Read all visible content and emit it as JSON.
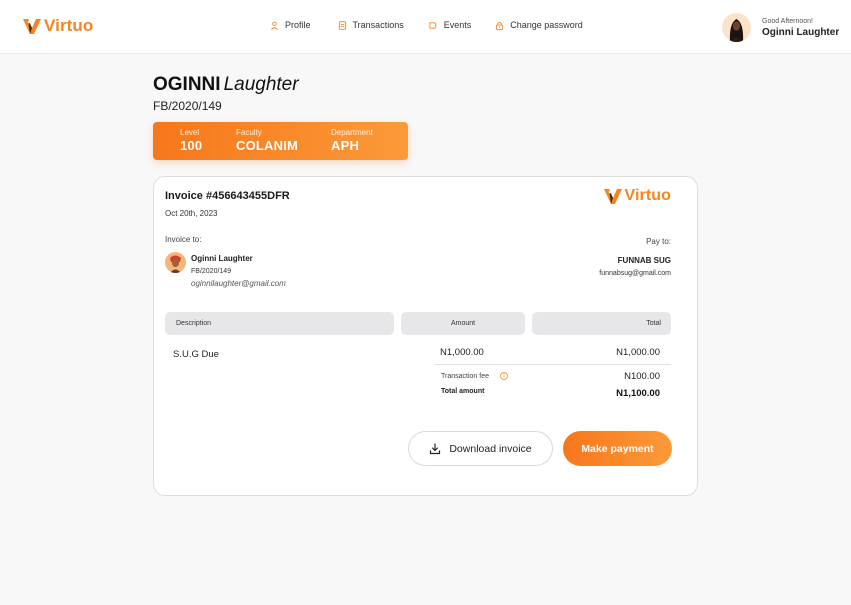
{
  "app": {
    "brand": "Virtuo",
    "accent_color": "#f7841f"
  },
  "nav": {
    "items": [
      {
        "label": "Profile",
        "icon": "user-icon"
      },
      {
        "label": "Transactions",
        "icon": "document-icon"
      },
      {
        "label": "Events",
        "icon": "ticket-icon"
      },
      {
        "label": "Change password",
        "icon": "lock-icon"
      }
    ]
  },
  "user": {
    "greeting": "Good Afternoon!",
    "name": "Oginni Laughter"
  },
  "student": {
    "surname": "OGINNI",
    "first_name": "Laughter",
    "matric": "FB/2020/149",
    "info": [
      {
        "label": "Level",
        "value": "100"
      },
      {
        "label": "Faculty",
        "value": "COLANIM"
      },
      {
        "label": "Department",
        "value": "APH"
      }
    ]
  },
  "invoice": {
    "title": "Invoice #456643455DFR",
    "date": "Oct 20th, 2023",
    "brand": "Virtuo",
    "invoice_to_label": "Invoice to:",
    "customer": {
      "name": "Oginni Laughter",
      "id": "FB/2020/149",
      "email": "oginnilaughter@gmail.com"
    },
    "pay_to_label": "Pay to:",
    "payee": {
      "name": "FUNNAB SUG",
      "email": "funnabsug@gmail.com"
    },
    "columns": [
      "Description",
      "Amount",
      "Total"
    ],
    "items": [
      {
        "description": "S.U.G Due",
        "amount": "N1,000.00",
        "total": "N1,000.00"
      }
    ],
    "fee_label": "Transaction fee",
    "fee_value": "N100.00",
    "total_label": "Total amount",
    "total_value": "N1,100.00",
    "download_label": "Download invoice",
    "pay_label": "Make payment"
  }
}
